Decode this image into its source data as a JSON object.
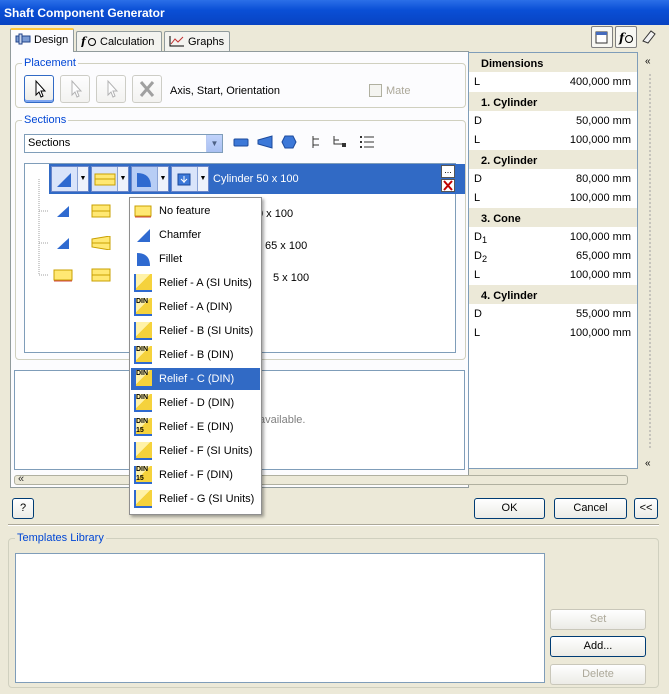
{
  "window": {
    "title": "Shaft Component Generator"
  },
  "tabs": [
    {
      "label": "Design"
    },
    {
      "label": "Calculation"
    },
    {
      "label": "Graphs"
    }
  ],
  "placement": {
    "group_label": "Placement",
    "description": "Axis, Start, Orientation",
    "mate_label": "Mate"
  },
  "sections": {
    "group_label": "Sections",
    "dropdown_value": "Sections",
    "selected_row_label": "Cylinder 50 x 100",
    "rows": [
      {
        "label": "0 x 100"
      },
      {
        "label": "65 x 100"
      },
      {
        "label": "5 x 100"
      }
    ]
  },
  "message": {
    "partial_text": "available."
  },
  "feature_menu": {
    "items": [
      {
        "label": "No feature",
        "icon": "no-feature-icon"
      },
      {
        "label": "Chamfer",
        "icon": "chamfer-icon"
      },
      {
        "label": "Fillet",
        "icon": "fillet-icon"
      },
      {
        "label": "Relief - A (SI Units)",
        "icon": "relief-a-si-icon"
      },
      {
        "label": "Relief - A (DIN)",
        "icon": "relief-a-din-icon"
      },
      {
        "label": "Relief - B (SI Units)",
        "icon": "relief-b-si-icon"
      },
      {
        "label": "Relief - B (DIN)",
        "icon": "relief-b-din-icon"
      },
      {
        "label": "Relief - C (DIN)",
        "icon": "relief-c-din-icon"
      },
      {
        "label": "Relief - D (DIN)",
        "icon": "relief-d-din-icon"
      },
      {
        "label": "Relief - E (DIN)",
        "icon": "relief-e-din-icon"
      },
      {
        "label": "Relief - F (SI Units)",
        "icon": "relief-f-si-icon"
      },
      {
        "label": "Relief - F (DIN)",
        "icon": "relief-f-din-icon"
      },
      {
        "label": "Relief - G (SI Units)",
        "icon": "relief-g-si-icon"
      }
    ],
    "selected_index": 7,
    "din_label": "DIN",
    "din15_label": "15"
  },
  "dimensions": {
    "header": "Dimensions",
    "total": {
      "name": "L",
      "value": "400,000 mm"
    },
    "groups": [
      {
        "title": "1. Cylinder",
        "rows": [
          {
            "name": "D",
            "sub": "",
            "value": "50,000 mm"
          },
          {
            "name": "L",
            "sub": "",
            "value": "100,000 mm"
          }
        ]
      },
      {
        "title": "2. Cylinder",
        "rows": [
          {
            "name": "D",
            "sub": "",
            "value": "80,000 mm"
          },
          {
            "name": "L",
            "sub": "",
            "value": "100,000 mm"
          }
        ]
      },
      {
        "title": "3. Cone",
        "rows": [
          {
            "name": "D",
            "sub": "1",
            "value": "100,000 mm"
          },
          {
            "name": "D",
            "sub": "2",
            "value": "65,000 mm"
          },
          {
            "name": "L",
            "sub": "",
            "value": "100,000 mm"
          }
        ]
      },
      {
        "title": "4. Cylinder",
        "rows": [
          {
            "name": "D",
            "sub": "",
            "value": "55,000 mm"
          },
          {
            "name": "L",
            "sub": "",
            "value": "100,000 mm"
          }
        ]
      }
    ]
  },
  "buttons": {
    "ok": "OK",
    "cancel": "Cancel",
    "collapse": "<<",
    "help": "?",
    "expand_up": "«",
    "ellipsis": "..."
  },
  "templates": {
    "group_label": "Templates Library",
    "set": "Set",
    "add": "Add...",
    "delete": "Delete"
  },
  "colors": {
    "selection": "#316ac5",
    "title_bar": "#0a4fd6",
    "group_label": "#0046d5"
  }
}
